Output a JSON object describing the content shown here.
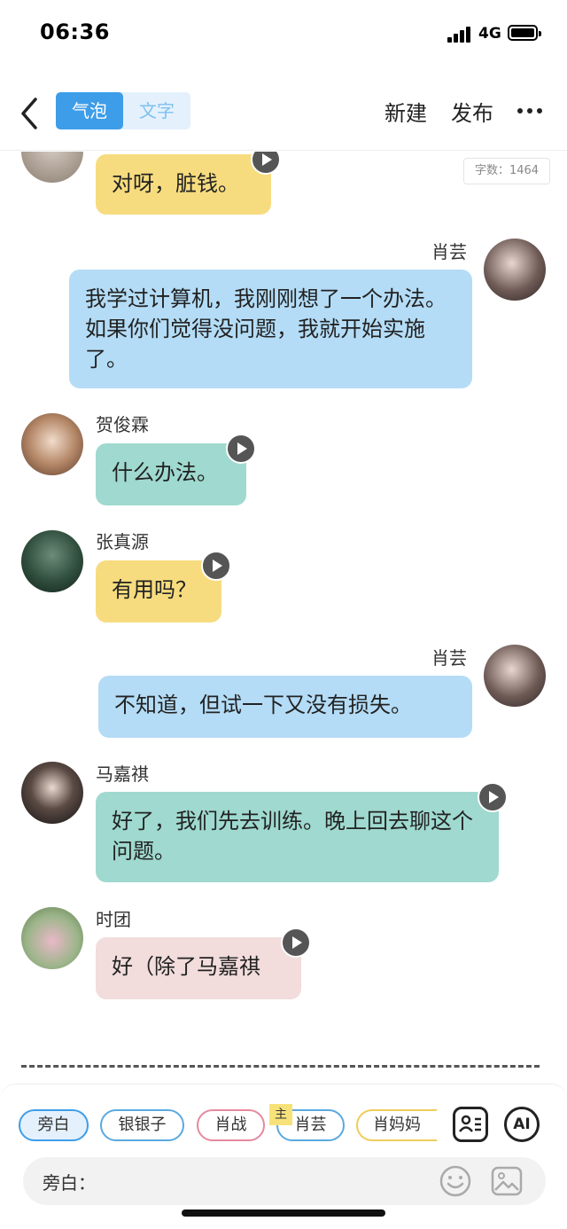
{
  "status_bar": {
    "time": "06:36",
    "network": "4G"
  },
  "nav": {
    "segments": [
      "气泡",
      "文字"
    ],
    "new_label": "新建",
    "publish_label": "发布"
  },
  "word_count": "字数：1464",
  "messages": [
    {
      "text": "对呀，脏钱。",
      "color": "#f7dc7f"
    },
    {
      "sender": "肖芸",
      "text": "我学过计算机，我刚刚想了一个办法。如果你们觉得没问题，我就开始实施了。",
      "color": "#b4dcf6"
    },
    {
      "sender": "贺俊霖",
      "text": "什么办法。",
      "color": "#9fd9cf"
    },
    {
      "sender": "张真源",
      "text": "有用吗？",
      "color": "#f7dc7f"
    },
    {
      "sender": "肖芸",
      "text": "不知道，但试一下又没有损失。",
      "color": "#b4dcf6"
    },
    {
      "sender": "马嘉祺",
      "text": "好了，我们先去训练。晚上回去聊这个问题。",
      "color": "#9fd9cf"
    },
    {
      "sender": "时团",
      "text": "好（除了马嘉祺",
      "color": "#f2dcdc"
    }
  ],
  "characters": [
    {
      "label": "旁白",
      "color": "#3d9de9"
    },
    {
      "label": "银银子",
      "color": "#5aa9e0"
    },
    {
      "label": "肖战",
      "color": "#e6899e"
    },
    {
      "label": "肖芸",
      "color": "#5aa9e0"
    },
    {
      "label": "肖妈妈",
      "color": "#efcc5a"
    }
  ],
  "host_badge": "主",
  "ai_label": "AI",
  "input_label": "旁白："
}
